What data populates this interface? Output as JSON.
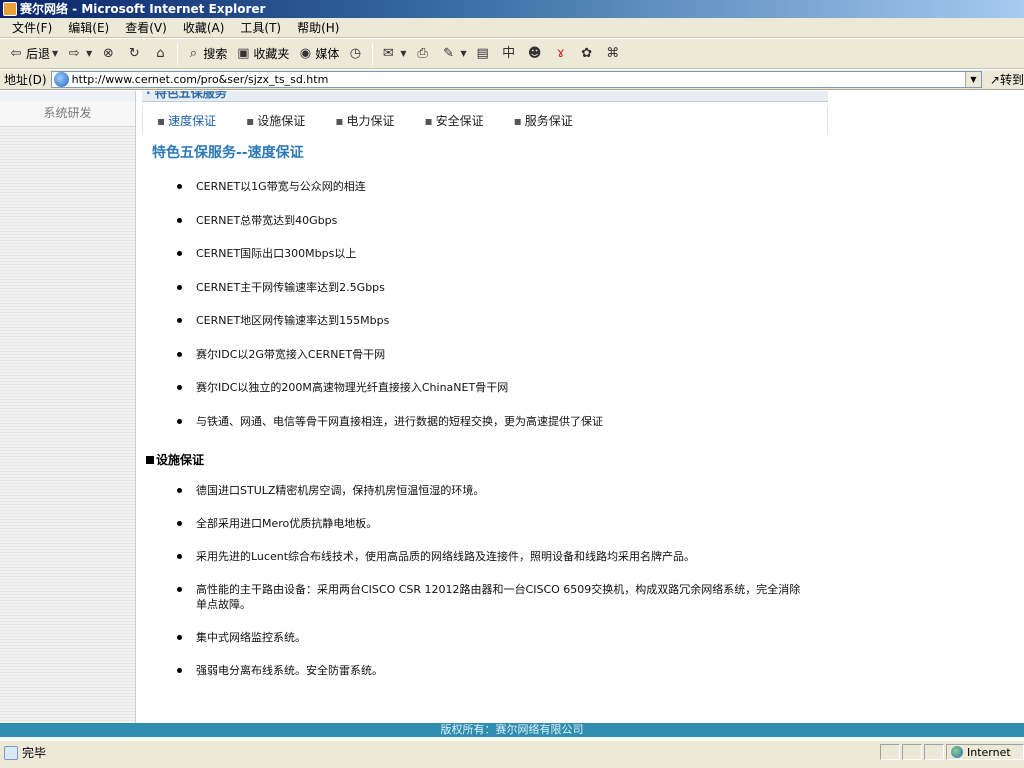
{
  "window": {
    "title": "赛尔网络 - Microsoft Internet Explorer"
  },
  "menubar": {
    "items": [
      "文件(F)",
      "编辑(E)",
      "查看(V)",
      "收藏(A)",
      "工具(T)",
      "帮助(H)"
    ]
  },
  "toolbar": {
    "back_label": "后退",
    "search_label": "搜索",
    "favorites_label": "收藏夹",
    "media_label": "媒体"
  },
  "address": {
    "label": "地址(D)",
    "url": "http://www.cernet.com/pro&ser/sjzx_ts_sd.htm",
    "go_label": "转到"
  },
  "sidebar": {
    "items": [
      {
        "label": "系统研发"
      }
    ]
  },
  "page": {
    "cut_header": "· 特色五保服务",
    "subnav": [
      {
        "label": "速度保证",
        "active": true
      },
      {
        "label": "设施保证",
        "active": false
      },
      {
        "label": "电力保证",
        "active": false
      },
      {
        "label": "安全保证",
        "active": false
      },
      {
        "label": "服务保证",
        "active": false
      }
    ],
    "section_title": "特色五保服务--速度保证",
    "speed_items": [
      "CERNET以1G带宽与公众网的相连",
      "CERNET总带宽达到40Gbps",
      "CERNET国际出口300Mbps以上",
      "CERNET主干网传输速率达到2.5Gbps",
      "CERNET地区网传输速率达到155Mbps",
      "赛尔IDC以2G带宽接入CERNET骨干网",
      "赛尔IDC以独立的200M高速物理光纤直接接入ChinaNET骨干网",
      "与铁通、网通、电信等骨干网直接相连，进行数据的短程交换，更为高速提供了保证"
    ],
    "section2_title": "设施保证",
    "facility_items": [
      "德国进口STULZ精密机房空调，保持机房恒温恒湿的环境。",
      "全部采用进口Mero优质抗静电地板。",
      "采用先进的Lucent综合布线技术，使用高品质的网络线路及连接件，照明设备和线路均采用名牌产品。",
      "高性能的主干路由设备：采用两台CISCO CSR 12012路由器和一台CISCO 6509交换机，构成双路冗余网络系统，完全消除单点故障。",
      "集中式网络监控系统。",
      "强弱电分离布线系统。安全防雷系统。"
    ],
    "footer": "版权所有：赛尔网络有限公司"
  },
  "statusbar": {
    "text": "完毕",
    "zone": "Internet"
  }
}
